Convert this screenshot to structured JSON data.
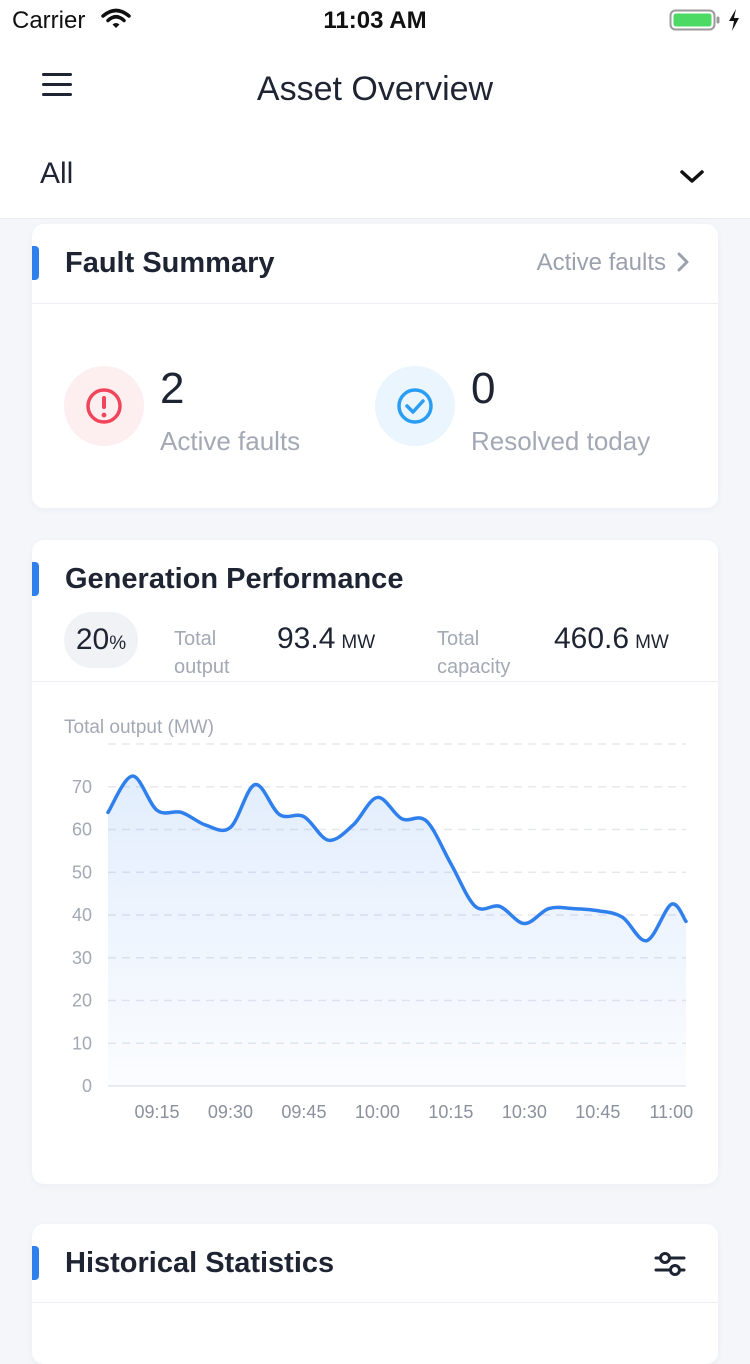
{
  "status_bar": {
    "carrier": "Carrier",
    "time": "11:03 AM"
  },
  "header": {
    "title": "Asset Overview"
  },
  "filter": {
    "selected": "All"
  },
  "fault_summary": {
    "title": "Fault Summary",
    "link_label": "Active faults",
    "active_count": "2",
    "active_label": "Active faults",
    "resolved_count": "0",
    "resolved_label": "Resolved today"
  },
  "generation": {
    "title": "Generation Performance",
    "percent_value": "20",
    "percent_unit": "%",
    "total_output_label_1": "Total",
    "total_output_label_2": "output",
    "total_output_value": "93.4",
    "total_output_unit": "MW",
    "total_capacity_label_1": "Total",
    "total_capacity_label_2": "capacity",
    "total_capacity_value": "460.6",
    "total_capacity_unit": "MW"
  },
  "history": {
    "title": "Historical Statistics"
  },
  "colors": {
    "accent": "#2f80ed",
    "fault_red": "#f0455b",
    "fault_bg": "#fdeef0",
    "resolved_blue": "#2a9df4",
    "resolved_bg": "#eaf5fe"
  },
  "chart_data": {
    "type": "area",
    "title": "Total output (MW)",
    "xlabel": "",
    "ylabel": "Total output (MW)",
    "ylim": [
      0,
      80
    ],
    "yticks": [
      0,
      10,
      20,
      30,
      40,
      50,
      60,
      70
    ],
    "xticks": [
      "09:15",
      "09:30",
      "09:45",
      "10:00",
      "10:15",
      "10:30",
      "10:45",
      "11:00"
    ],
    "x": [
      "09:05",
      "09:10",
      "09:15",
      "09:20",
      "09:25",
      "09:30",
      "09:35",
      "09:40",
      "09:45",
      "09:50",
      "09:55",
      "10:00",
      "10:05",
      "10:10",
      "10:15",
      "10:20",
      "10:25",
      "10:30",
      "10:35",
      "10:40",
      "10:45",
      "10:50",
      "10:55",
      "11:00",
      "11:03"
    ],
    "series": [
      {
        "values": [
          64,
          72.5,
          64.5,
          64,
          61,
          60.5,
          70.5,
          63.5,
          63,
          57.5,
          61,
          67.5,
          62.5,
          62,
          52,
          42,
          42,
          38,
          41.5,
          41.5,
          41,
          39.5,
          34,
          42.5,
          38.5
        ]
      }
    ],
    "grid": true
  }
}
